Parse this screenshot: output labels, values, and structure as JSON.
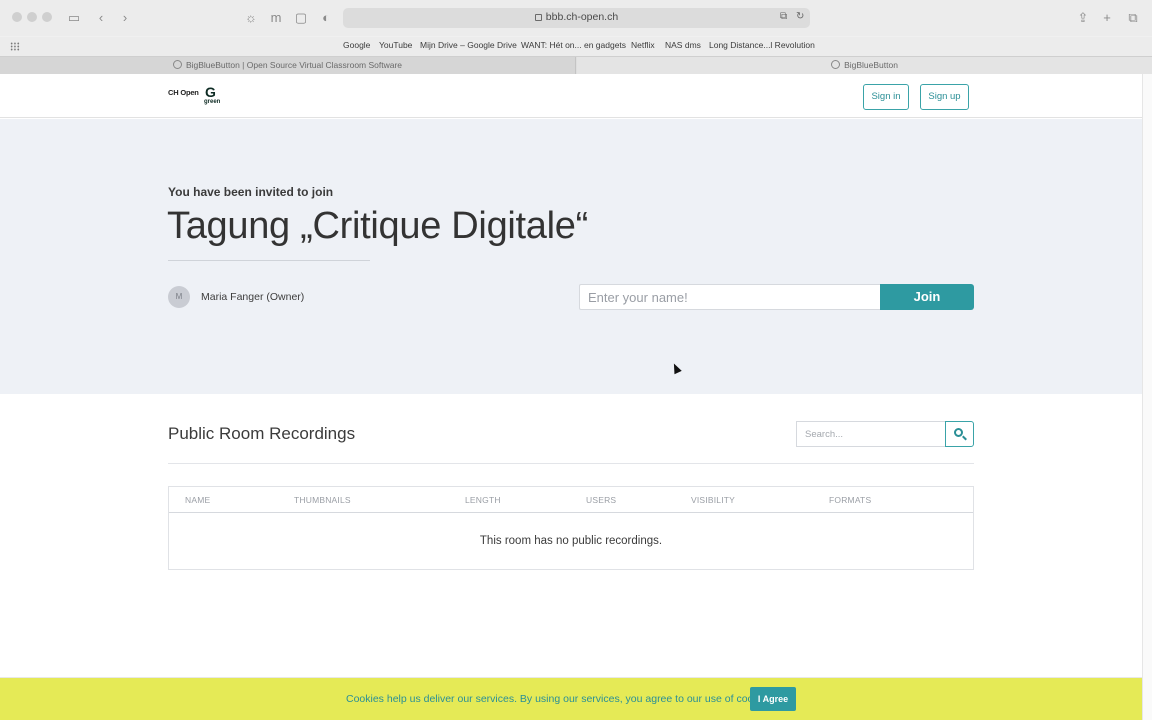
{
  "browser": {
    "url": "bbb.ch-open.ch",
    "bookmarks": [
      "Google",
      "YouTube",
      "Mijn Drive – Google Drive",
      "WANT: Hét on... en gadgets",
      "Netflix",
      "NAS dms",
      "Long Distance...l Revolution"
    ],
    "tabs": [
      {
        "title": "BigBlueButton | Open Source Virtual Classroom Software"
      },
      {
        "title": "BigBlueButton"
      }
    ]
  },
  "header": {
    "logo_text": "CH Open",
    "logo_subtext": "green",
    "sign_in": "Sign in",
    "sign_up": "Sign up"
  },
  "hero": {
    "invited_text": "You have been invited to join",
    "room_title": "Tagung „Critique Digitale“",
    "owner_initial": "M",
    "owner_name": "Maria Fanger (Owner)",
    "name_placeholder": "Enter your name!",
    "join_label": "Join"
  },
  "recordings": {
    "title": "Public Room Recordings",
    "search_placeholder": "Search...",
    "columns": [
      "NAME",
      "THUMBNAILS",
      "LENGTH",
      "USERS",
      "VISIBILITY",
      "FORMATS"
    ],
    "empty_message": "This room has no public recordings."
  },
  "cookie_banner": {
    "text": "Cookies help us deliver our services. By using our services, you agree to our use of cookies.",
    "agree_label": "I Agree"
  },
  "colors": {
    "accent": "#2e9aa1",
    "hero_bg": "#eef1f6",
    "cookie_bg": "#e5ea56"
  }
}
